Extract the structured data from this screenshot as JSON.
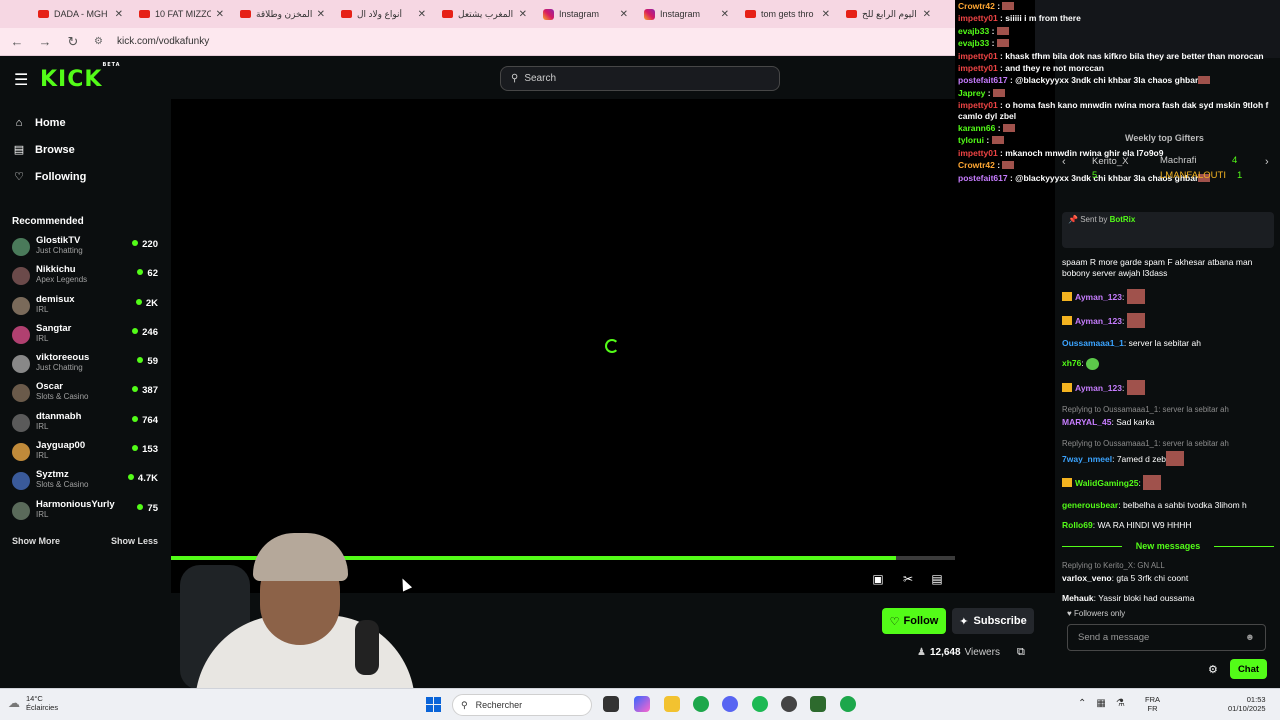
{
  "browser": {
    "tabs": [
      {
        "title": "DADA - MGH",
        "icon": "youtube-icon"
      },
      {
        "title": "10 FAT MIZZO",
        "icon": "youtube-icon"
      },
      {
        "title": "المخزن وطلاقة",
        "icon": "youtube-icon"
      },
      {
        "title": "أنواع ولاد ال",
        "icon": "youtube-icon"
      },
      {
        "title": "المغرب يشتعل",
        "icon": "youtube-icon"
      },
      {
        "title": "Instagram",
        "icon": "instagram-icon"
      },
      {
        "title": "Instagram",
        "icon": "instagram-icon"
      },
      {
        "title": "tom gets thro",
        "icon": "youtube-icon"
      },
      {
        "title": "اليوم الرابع للح",
        "icon": "youtube-icon"
      }
    ],
    "url": "kick.com/vodkafunky",
    "chat_tab_title": "vodkafunky"
  },
  "kick": {
    "logo": "KICK",
    "logo_badge": "BETA",
    "search_placeholder": "Search",
    "nav": [
      {
        "label": "Home",
        "icon": "home-icon"
      },
      {
        "label": "Browse",
        "icon": "browse-icon"
      },
      {
        "label": "Following",
        "icon": "heart-icon"
      }
    ],
    "recommended_title": "Recommended",
    "channels": [
      {
        "name": "GlostikTV",
        "category": "Just Chatting",
        "viewers": "220",
        "color": "#4a7a5a"
      },
      {
        "name": "Nikkichu",
        "category": "Apex Legends",
        "viewers": "62",
        "color": "#6b4a4a"
      },
      {
        "name": "demisux",
        "category": "IRL",
        "viewers": "2K",
        "color": "#7a6a5a"
      },
      {
        "name": "Sangtar",
        "category": "IRL",
        "viewers": "246",
        "color": "#b04070"
      },
      {
        "name": "viktoreeous",
        "category": "Just Chatting",
        "viewers": "59",
        "color": "#888888"
      },
      {
        "name": "Oscar",
        "category": "Slots & Casino",
        "viewers": "387",
        "color": "#6a5a4a"
      },
      {
        "name": "dtanmabh",
        "category": "IRL",
        "viewers": "764",
        "color": "#5a5a5a"
      },
      {
        "name": "Jayguap00",
        "category": "IRL",
        "viewers": "153",
        "color": "#c08a3a"
      },
      {
        "name": "Syztmz",
        "category": "Slots & Casino",
        "viewers": "4.7K",
        "color": "#3a5a9a"
      },
      {
        "name": "HarmoniousYurly",
        "category": "IRL",
        "viewers": "75",
        "color": "#5a6a5a"
      }
    ],
    "show_more": "Show More",
    "show_less": "Show Less",
    "progress_fraction": 0.82,
    "follow_label": "Follow",
    "subscribe_label": "Subscribe",
    "viewers_count": "12,648",
    "viewers_label": "Viewers"
  },
  "overlay_chat": [
    {
      "user": "Crowtr42",
      "text": "",
      "color": "o",
      "emote": true
    },
    {
      "user": "impetty01",
      "text": "siiiii i m from there",
      "color": "r"
    },
    {
      "user": "evajb33",
      "text": "",
      "color": "g",
      "emote": true
    },
    {
      "user": "evajb33",
      "text": "",
      "color": "g",
      "emote": true
    },
    {
      "user": "impetty01",
      "text": "khask tfhm bila dok nas kifkro bila they are better than morocan",
      "color": "r"
    },
    {
      "user": "impetty01",
      "text": "and they re not morccan",
      "color": "r"
    },
    {
      "user": "postefait617",
      "text": "@blackyyyxx 3ndk chi khbar 3la chaos ghbar",
      "color": "p",
      "emote": true
    },
    {
      "user": "Japrey",
      "text": "",
      "color": "g",
      "emote": true
    },
    {
      "user": "impetty01",
      "text": "o homa fash kano mnwdin rwina mora fash dak syd mskin 9tloh f camlo dyl zbel",
      "color": "r"
    },
    {
      "user": "karann66",
      "text": "",
      "color": "g",
      "emote": true
    },
    {
      "user": "tylorui",
      "text": "",
      "color": "g",
      "emote": true
    },
    {
      "user": "impetty01",
      "text": "mkanoch mnwdin rwina ghir ela l7o9o9",
      "color": "r"
    },
    {
      "user": "Crowtr42",
      "text": "",
      "color": "o",
      "emote": true
    },
    {
      "user": "postefait617",
      "text": "@blackyyyxx 3ndk chi khbar 3la chaos ghbar",
      "color": "p",
      "emote": true
    }
  ],
  "side_chat": {
    "weekly_gifters_title": "Weekly top Gifters",
    "gifters": [
      {
        "name": "Kerito_X",
        "count": "5"
      },
      {
        "name": "Machrafi",
        "count": "4"
      },
      {
        "name": "LMANFALOUTI",
        "count": "1"
      }
    ],
    "pinned_sender_prefix": "Sent by",
    "pinned_sender": "BotRix",
    "messages": [
      {
        "reply": "",
        "user": "",
        "text": "spaam R more garde spam F akhesar atbana man bobony server awjah l3dass",
        "ucolor": "#fff",
        "emote": "",
        "badge": false
      },
      {
        "reply": "",
        "user": "Ayman_123",
        "text": "",
        "ucolor": "#c77dff",
        "emote": "photo",
        "badge": true
      },
      {
        "reply": "",
        "user": "Ayman_123",
        "text": "",
        "ucolor": "#c77dff",
        "emote": "photo",
        "badge": true
      },
      {
        "reply": "",
        "user": "Oussamaaa1_1",
        "text": "server la sebitar ah",
        "ucolor": "#3ba4ff",
        "emote": "",
        "badge": false
      },
      {
        "reply": "",
        "user": "xh76",
        "text": "",
        "ucolor": "#53fc18",
        "emote": "pepe",
        "badge": false
      },
      {
        "reply": "",
        "user": "Ayman_123",
        "text": "",
        "ucolor": "#c77dff",
        "emote": "photo",
        "badge": true
      },
      {
        "reply": "Replying to Oussamaaa1_1: server la sebitar ah",
        "user": "MARYAL_45",
        "text": "Sad karka",
        "ucolor": "#c77dff",
        "emote": "",
        "badge": false
      },
      {
        "reply": "Replying to Oussamaaa1_1: server la sebitar ah",
        "user": "7way_nmeel",
        "text": "7amed d zeb",
        "ucolor": "#3ba4ff",
        "emote": "photo",
        "badge": false
      },
      {
        "reply": "",
        "user": "WalidGaming25",
        "text": "",
        "ucolor": "#53fc18",
        "emote": "photo",
        "badge": true
      },
      {
        "reply": "",
        "user": "generousbear",
        "text": "belbelha a sahbi tvodka 3lihom h",
        "ucolor": "#53fc18",
        "emote": "",
        "badge": false
      },
      {
        "reply": "",
        "user": "Rollo69",
        "text": "WA RA HINDI W9 HHHH",
        "ucolor": "#53fc18",
        "emote": "",
        "badge": false
      }
    ],
    "new_messages_label": "New messages",
    "messages_after": [
      {
        "reply": "Replying to Kerito_X: GN ALL",
        "user": "varlox_veno",
        "text": "gta 5 3rfk chi coont",
        "ucolor": "#fff",
        "emote": "",
        "badge": false
      },
      {
        "reply": "",
        "user": "Mehauk",
        "text": "Yassir bloki had oussama",
        "ucolor": "#fff",
        "emote": "",
        "badge": false
      }
    ],
    "followers_only": "Followers only",
    "input_placeholder": "Send a message",
    "chat_button": "Chat"
  },
  "taskbar": {
    "weather_temp": "14°C",
    "weather_desc": "Éclaircies",
    "search_label": "Rechercher",
    "lang_top": "FRA",
    "lang_bottom": "FR",
    "time": "01:53",
    "date": "01/10/2025"
  }
}
